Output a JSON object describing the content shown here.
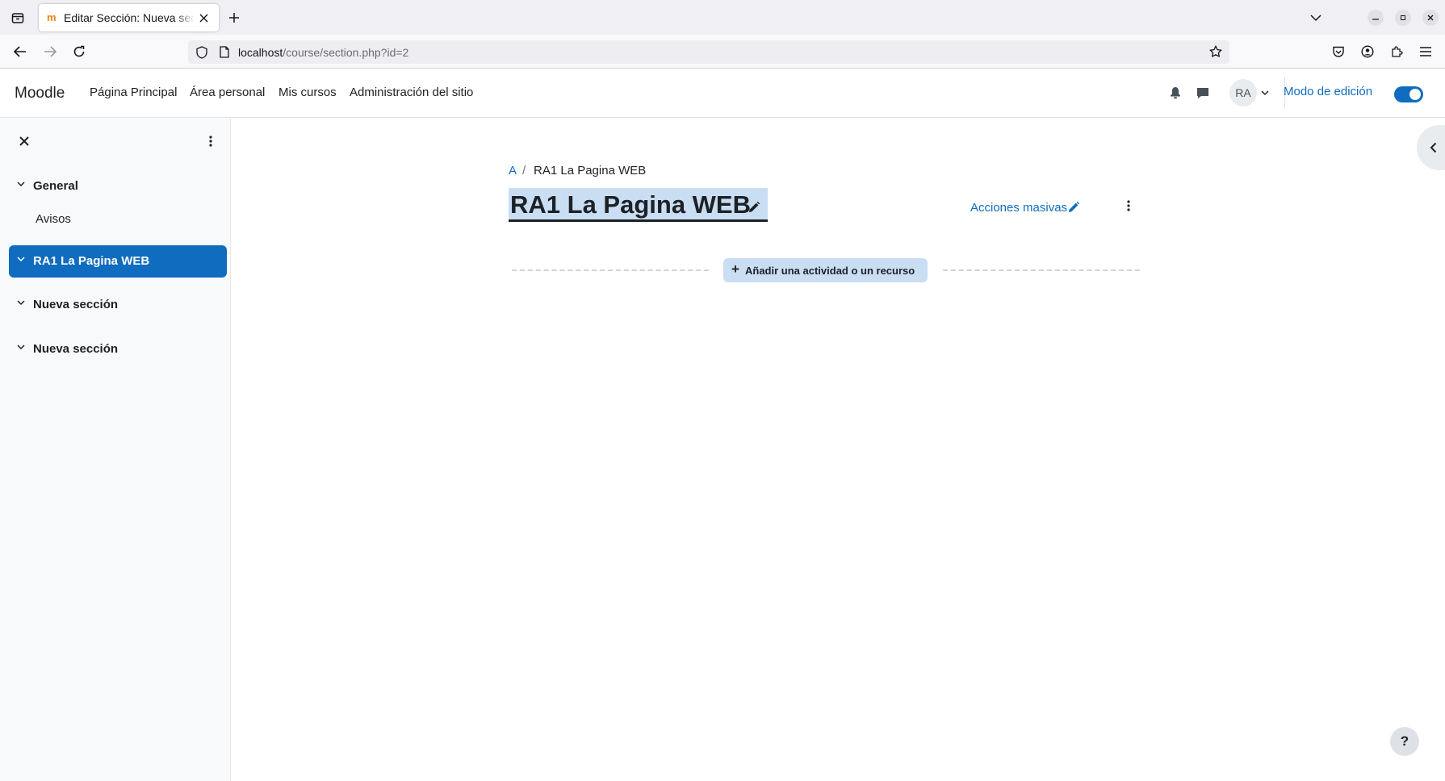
{
  "browser": {
    "tab_title": "Editar Sección: Nueva sección",
    "url_host": "localhost",
    "url_path": "/course/section.php?id=2"
  },
  "header": {
    "brand": "Moodle",
    "nav": [
      "Página Principal",
      "Área personal",
      "Mis cursos",
      "Administración del sitio"
    ],
    "avatar_initials": "RA",
    "edit_mode_label": "Modo de edición",
    "edit_mode_on": true
  },
  "drawer": {
    "sections": [
      {
        "label": "General",
        "active": false
      },
      {
        "label": "RA1 La Pagina WEB",
        "active": true
      },
      {
        "label": "Nueva sección",
        "active": false
      },
      {
        "label": "Nueva sección",
        "active": false
      }
    ],
    "general_items": [
      "Avisos"
    ]
  },
  "main": {
    "breadcrumb": [
      "A",
      "RA1 La Pagina WEB"
    ],
    "section_title": "RA1 La Pagina WEB",
    "bulk_actions": "Acciones masivas",
    "add_activity": "Añadir una actividad o un recurso"
  },
  "help_label": "?",
  "colors": {
    "accent": "#0f6cbf",
    "selection": "#c9def3"
  }
}
